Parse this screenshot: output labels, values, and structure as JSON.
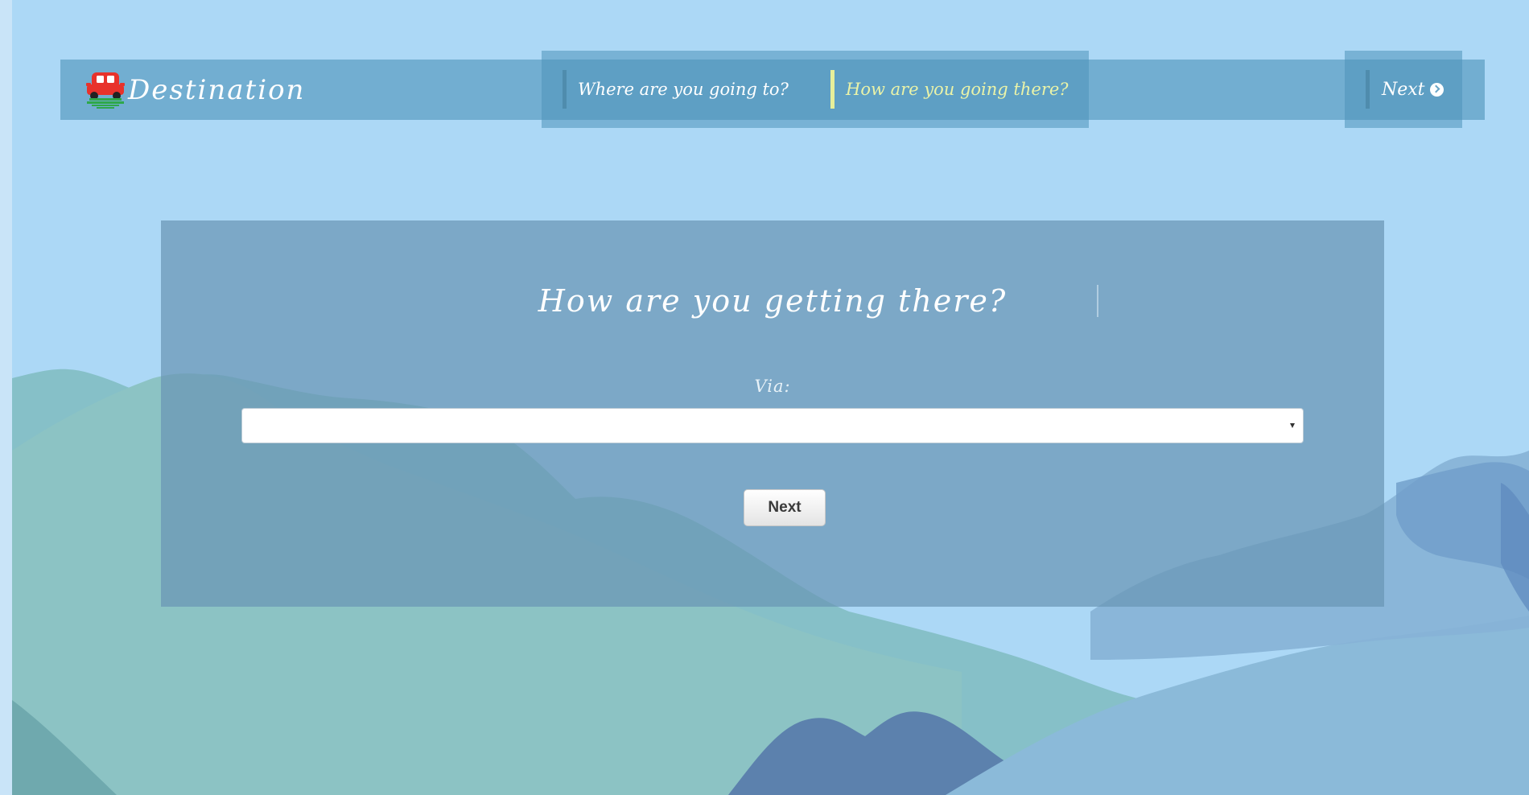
{
  "brand": {
    "name": "Destination",
    "logo_icon": "car-icon"
  },
  "nav": {
    "steps": [
      {
        "label": "Where are you going to?",
        "active": false
      },
      {
        "label": "How are you going there?",
        "active": true
      }
    ],
    "next_label": "Next",
    "next_icon": "chevron-circle-right-icon"
  },
  "form": {
    "title": "How are you getting there?",
    "via_label": "Via:",
    "via_value": "",
    "submit_label": "Next"
  },
  "colors": {
    "sky": "#acd8f6",
    "active_step": "#eaf3a8",
    "panel": "#6996b4",
    "logo_red": "#e8322b",
    "logo_green": "#2ea84a"
  }
}
